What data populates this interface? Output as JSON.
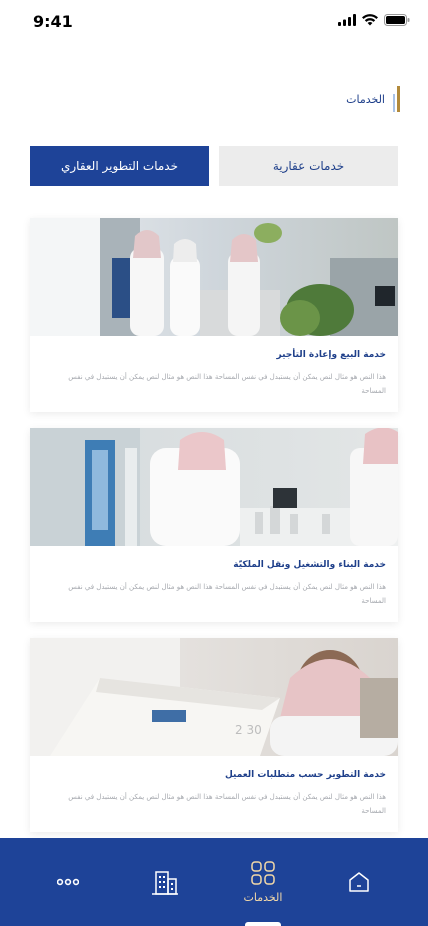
{
  "status_bar": {
    "time": "9:41"
  },
  "section": {
    "title": "الخدمات"
  },
  "tabs": [
    {
      "label": "خدمات التطوير العقاري",
      "active": true
    },
    {
      "label": "خدمات عقارية",
      "active": false
    }
  ],
  "cards": [
    {
      "title": "خدمة البيع وإعادة التأجير",
      "description": "هذا النص هو مثال لنص يمكن أن يستبدل في نفس المساحة هذا النص هو مثال لنص يمكن أن يستبدل في نفس المساحة",
      "image": "office-reception-photo"
    },
    {
      "title": "خدمة البناء والتشغيل ونقل الملكيّة",
      "description": "هذا النص هو مثال لنص يمكن أن يستبدل في نفس المساحة هذا النص هو مثال لنص يمكن أن يستبدل في نفس المساحة",
      "image": "architectural-model-photo"
    },
    {
      "title": "خدمة التطوير حسب متطلبات العميل",
      "description": "هذا النص هو مثال لنص يمكن أن يستبدل في نفس المساحة هذا النص هو مثال لنص يمكن أن يستبدل في نفس المساحة",
      "image": "document-review-photo"
    }
  ],
  "bottom_nav": {
    "items": [
      {
        "icon": "more-dots-icon",
        "label": ""
      },
      {
        "icon": "building-icon",
        "label": ""
      },
      {
        "icon": "grid-services-icon",
        "label": "الخدمات",
        "active": true
      },
      {
        "icon": "home-icon",
        "label": ""
      }
    ]
  },
  "colors": {
    "primary": "#1e4398",
    "accent_gold": "#b28a3c",
    "tab_inactive_bg": "#ececec",
    "nav_label": "#f3d9a8"
  }
}
